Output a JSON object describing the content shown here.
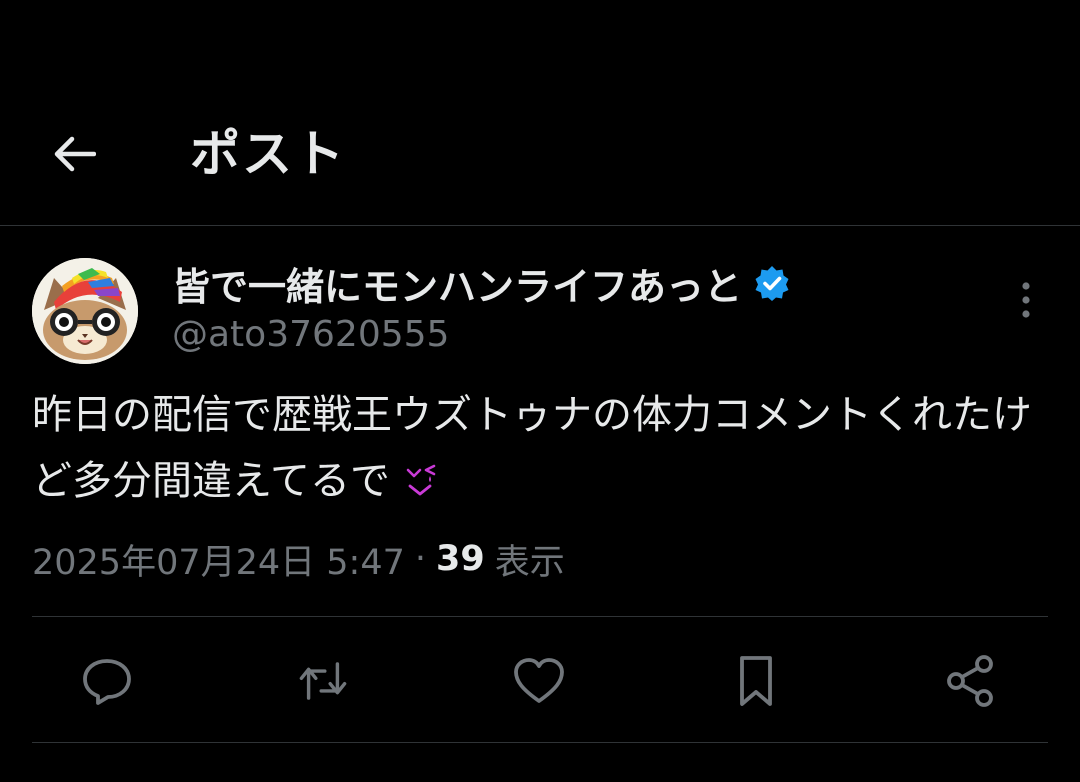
{
  "header": {
    "title": "ポスト",
    "back_icon": "arrow-left-icon"
  },
  "author": {
    "display_name": "皆で一緒にモンハンライフあっと",
    "handle": "@ato37620555",
    "verified": true,
    "verified_color": "#1d9bf0"
  },
  "tweet": {
    "text": "昨日の配信で歴戦王ウズトゥナの体力コメントくれたけど多分間違えてるで",
    "emoji": "smiling-face-with-tear-emoji",
    "date": "2025年07月24日 5:47",
    "separator": "·",
    "view_count": "39",
    "view_label": "表示"
  },
  "actions": [
    {
      "name": "reply",
      "icon": "reply-bubble-icon"
    },
    {
      "name": "repost",
      "icon": "repost-icon"
    },
    {
      "name": "like",
      "icon": "heart-icon"
    },
    {
      "name": "bookmark",
      "icon": "bookmark-icon"
    },
    {
      "name": "share",
      "icon": "share-icon"
    }
  ],
  "colors": {
    "background": "#000000",
    "primary_text": "#e7e9ea",
    "secondary_text": "#71767b",
    "divider": "#2f3336",
    "accent": "#1d9bf0"
  }
}
